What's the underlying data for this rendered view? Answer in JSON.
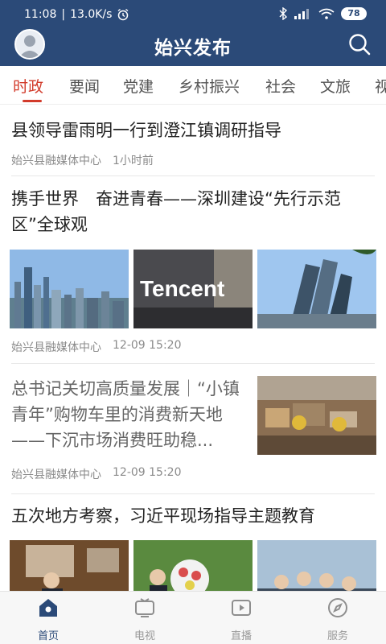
{
  "status_bar": {
    "time": "11:08",
    "speed": "13.0K/s",
    "battery": "78",
    "net": "Nil"
  },
  "app": {
    "title": "始兴发布"
  },
  "tabs": [
    {
      "label": "时政",
      "active": true
    },
    {
      "label": "要闻",
      "active": false
    },
    {
      "label": "党建",
      "active": false
    },
    {
      "label": "乡村振兴",
      "active": false
    },
    {
      "label": "社会",
      "active": false
    },
    {
      "label": "文旅",
      "active": false
    },
    {
      "label": "视",
      "active": false
    }
  ],
  "feed": {
    "items": [
      {
        "title": "县领导雷雨明一行到澄江镇调研指导",
        "source": "始兴县融媒体中心",
        "time": "1小时前"
      },
      {
        "title": "携手世界　奋进青春——深圳建设“先行示范区”全球观",
        "source": "始兴县融媒体中心",
        "time": "12-09 15:20",
        "images": [
          "city-skyline-image",
          "tencent-sign-image",
          "towers-image"
        ]
      },
      {
        "title": "总书记关切高质量发展｜“小镇青年”购物车里的消费新天地——下沉市场消费旺助稳...",
        "source": "始兴县融媒体中心",
        "time": "12-09 15:20",
        "images": [
          "delivery-workers-image"
        ]
      },
      {
        "title": "五次地方考察，习近平现场指导主题教育",
        "images": [
          "exhibition-image",
          "flower-wreath-image",
          "crowd-image"
        ]
      }
    ]
  },
  "bottom_nav": [
    {
      "label": "首页",
      "icon": "home-icon",
      "active": true
    },
    {
      "label": "电视",
      "icon": "tv-icon",
      "active": false
    },
    {
      "label": "直播",
      "icon": "live-icon",
      "active": false
    },
    {
      "label": "服务",
      "icon": "compass-icon",
      "active": false
    }
  ],
  "colors": {
    "brand": "#2b4a78",
    "accent": "#d23b2b"
  }
}
